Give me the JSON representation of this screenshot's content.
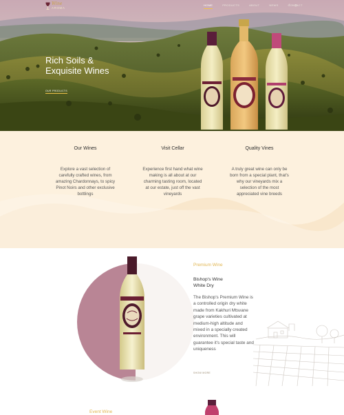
{
  "logo": {
    "script_text": "Wine",
    "sub_text": "AROMA"
  },
  "nav": {
    "items": [
      {
        "label": "HOME",
        "active": true
      },
      {
        "label": "PRODUCTS",
        "active": false
      },
      {
        "label": "ABOUT",
        "active": false
      },
      {
        "label": "NEWS",
        "active": false
      },
      {
        "label": "CONTACT",
        "active": false
      }
    ],
    "social": [
      "f",
      "◎"
    ]
  },
  "hero": {
    "title_line1": "Rich Soils &",
    "title_line2": "Exquisite Wines",
    "button_label": "OUR PRODUCTS"
  },
  "features": [
    {
      "title": "Our Wines",
      "text": "Explore a vast selection of carefully crafted wines, from amazing Chardonnays, to spicy Pinot Noirs and other exclusive bottlings"
    },
    {
      "title": "Visit Cellar",
      "text": "Experience first hand what wine making is all about at our charming tasting room, located at our estate, just off the vast vineyards"
    },
    {
      "title": "Quality Vines",
      "text": "A truly great wine can only be born from a special plant, that's why our vineyards mix a selection of the most appreciated vine breeds"
    }
  ],
  "product": {
    "kicker": "Premium Wine",
    "title_line1": "Bishop's Wine",
    "title_line2": "White Dry",
    "description": "The Bishop's Premium Wine is a controlled origin dry white made from Kakhuri Mtsvane grape varieties cultivated at medium-high altitude and mixed in a specially created environment. This will guarantee it's special taste and uniqueness",
    "more_label": "SHOW MORE"
  },
  "event": {
    "kicker": "Event Wine"
  },
  "colors": {
    "accent_gold": "#f0c24a",
    "cream": "#fdf1de",
    "mauve_circle": "#b98595"
  }
}
